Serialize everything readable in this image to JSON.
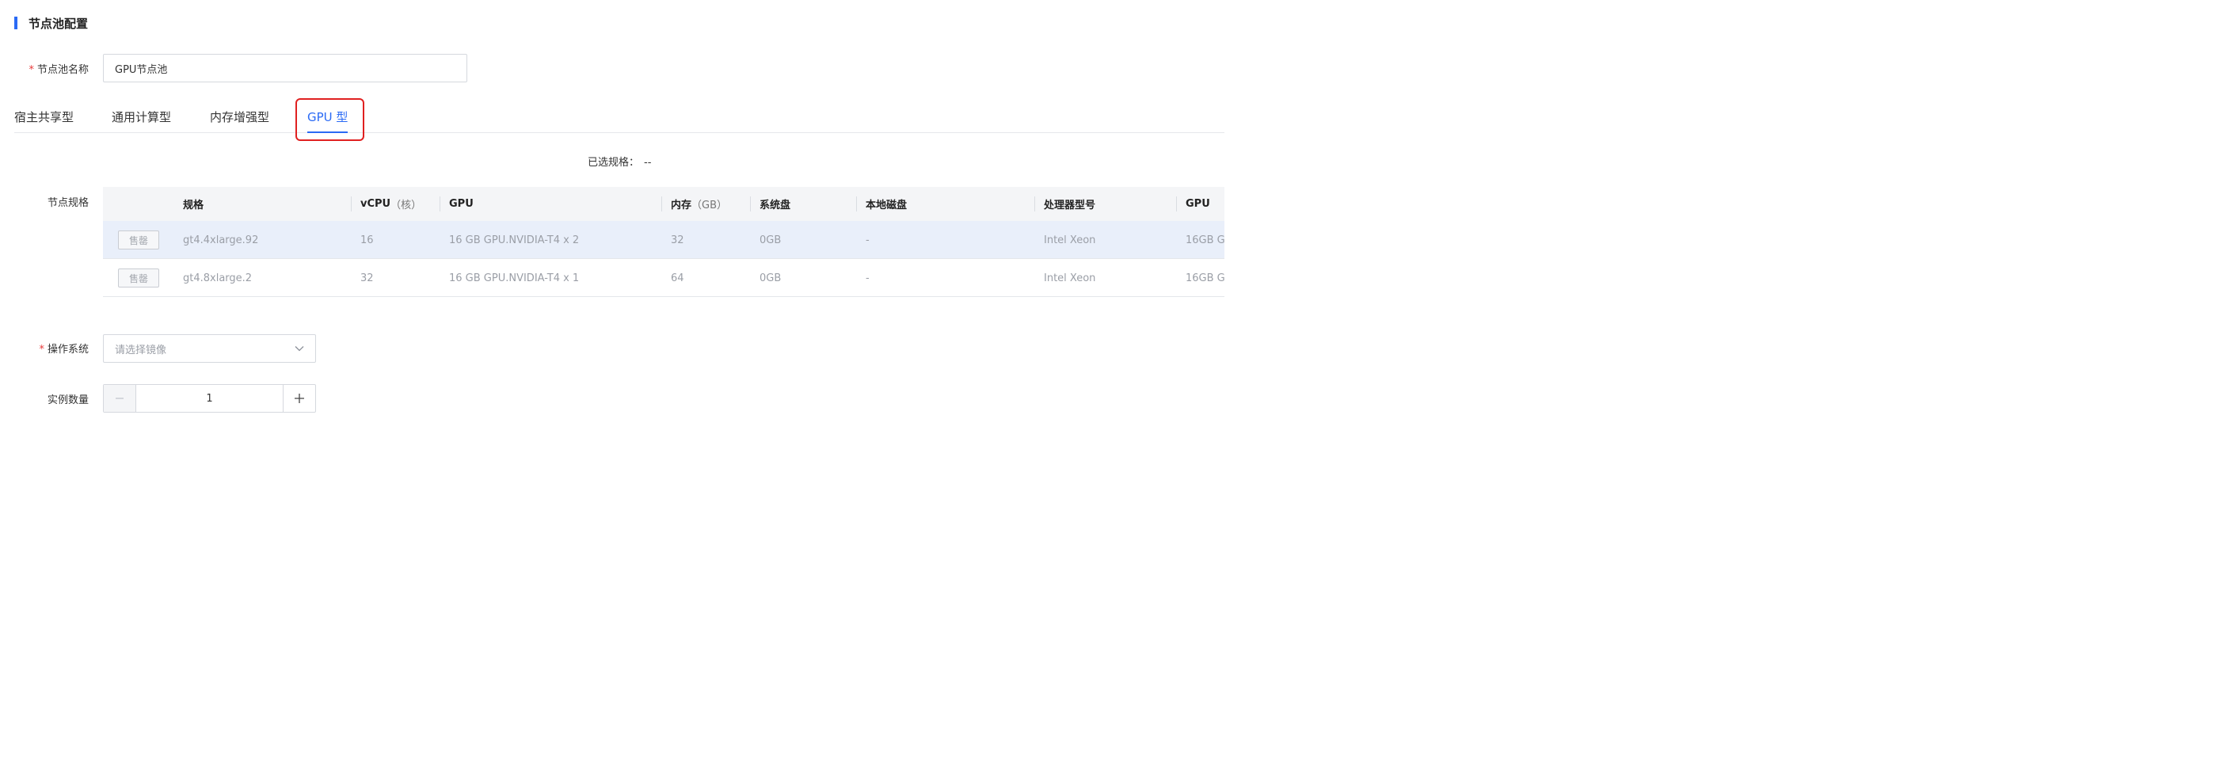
{
  "section": {
    "title": "节点池配置"
  },
  "pool_name": {
    "label": "节点池名称",
    "required_mark": "*",
    "value": "GPU节点池"
  },
  "tabs": [
    {
      "label": "宿主共享型",
      "active": false
    },
    {
      "label": "通用计算型",
      "active": false
    },
    {
      "label": "内存增强型",
      "active": false
    },
    {
      "label": "GPU 型",
      "active": true
    }
  ],
  "selected_spec": {
    "label": "已选规格：",
    "value": "--"
  },
  "spec": {
    "label": "节点规格",
    "columns": [
      "规格",
      "vCPU",
      "（核）",
      "GPU",
      "内存",
      "（GB）",
      "系统盘",
      "本地磁盘",
      "处理器型号",
      "GPU"
    ],
    "rows": [
      {
        "status": "售罄",
        "name": "gt4.4xlarge.92",
        "vcpu": "16",
        "gpu": "16 GB GPU.NVIDIA-T4 x 2",
        "memory": "32",
        "system_disk": "0GB",
        "local_disk": "-",
        "cpu_model": "Intel Xeon",
        "gpu_mem": "16GB G"
      },
      {
        "status": "售罄",
        "name": "gt4.8xlarge.2",
        "vcpu": "32",
        "gpu": "16 GB GPU.NVIDIA-T4 x 1",
        "memory": "64",
        "system_disk": "0GB",
        "local_disk": "-",
        "cpu_model": "Intel Xeon",
        "gpu_mem": "16GB G"
      }
    ]
  },
  "os": {
    "label": "操作系统",
    "required_mark": "*",
    "placeholder": "请选择镜像"
  },
  "instances": {
    "label": "实例数量",
    "value": "1"
  },
  "colors": {
    "accent": "#2a6af5",
    "required": "#e83a3a",
    "highlight": "#e02020",
    "selected_row": "#e9effa"
  }
}
